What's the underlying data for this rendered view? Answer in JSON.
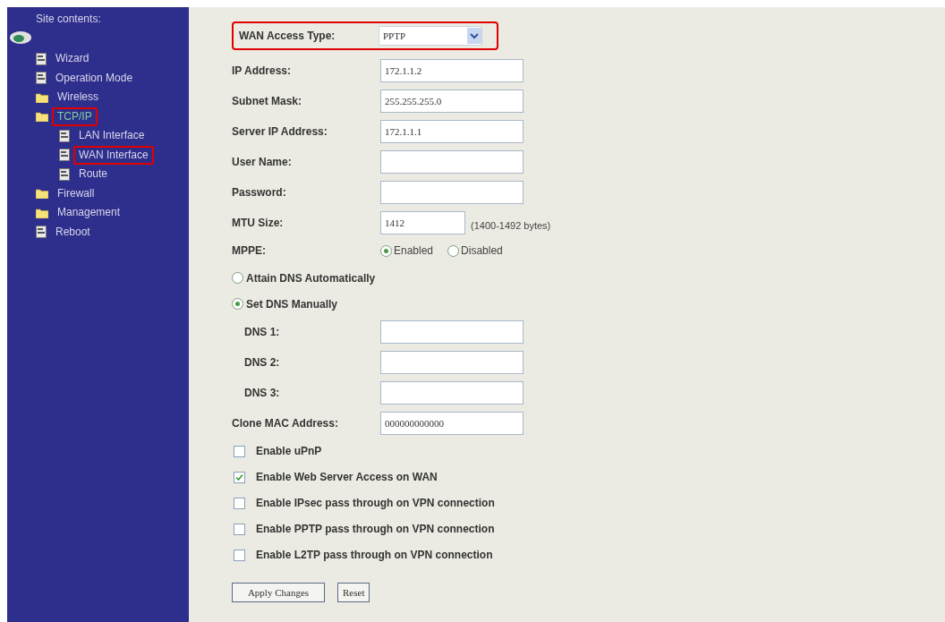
{
  "sidebar": {
    "title": "Site contents:",
    "items": [
      {
        "label": "Wizard",
        "kind": "page",
        "highlighted": false
      },
      {
        "label": "Operation Mode",
        "kind": "page",
        "highlighted": false
      },
      {
        "label": "Wireless",
        "kind": "folder",
        "highlighted": false
      },
      {
        "label": "TCP/IP",
        "kind": "folder",
        "highlighted": true,
        "expanded": true,
        "children": [
          {
            "label": "LAN Interface",
            "kind": "page",
            "highlighted": false
          },
          {
            "label": "WAN Interface",
            "kind": "page",
            "highlighted": true
          },
          {
            "label": "Route",
            "kind": "page",
            "highlighted": false
          }
        ]
      },
      {
        "label": "Firewall",
        "kind": "folder",
        "highlighted": false
      },
      {
        "label": "Management",
        "kind": "folder",
        "highlighted": false
      },
      {
        "label": "Reboot",
        "kind": "page",
        "highlighted": false
      }
    ]
  },
  "access_type": {
    "label": "WAN Access Type:",
    "value": "PPTP",
    "highlighted": true
  },
  "fields": [
    {
      "label": "IP Address:",
      "value": "172.1.1.2"
    },
    {
      "label": "Subnet Mask:",
      "value": "255.255.255.0"
    },
    {
      "label": "Server IP Address:",
      "value": "172.1.1.1"
    },
    {
      "label": "User Name:"
    },
    {
      "label": "Password:"
    },
    {
      "label": "MTU Size:",
      "value": "1412",
      "hint": "(1400-1492 bytes)"
    }
  ],
  "mppe": {
    "label": "MPPE:",
    "options": [
      {
        "label": "Enabled",
        "selected": true
      },
      {
        "label": "Disabled",
        "selected": false
      }
    ]
  },
  "dns_mode": [
    {
      "label": "Attain DNS Automatically",
      "selected": false
    },
    {
      "label": "Set DNS Manually",
      "selected": true
    }
  ],
  "dns_fields": [
    {
      "label": "DNS 1:"
    },
    {
      "label": "DNS 2:"
    },
    {
      "label": "DNS 3:"
    }
  ],
  "clone_mac": {
    "label": "Clone MAC Address:",
    "value": "000000000000"
  },
  "checkboxes": [
    {
      "label": "Enable uPnP",
      "checked": false
    },
    {
      "label": "Enable Web Server Access on WAN",
      "checked": true
    },
    {
      "label": "Enable IPsec pass through on VPN connection",
      "checked": false
    },
    {
      "label": "Enable PPTP pass through on VPN connection",
      "checked": false
    },
    {
      "label": "Enable L2TP pass through on VPN connection",
      "checked": false
    }
  ],
  "buttons": [
    "Apply Changes",
    "Reset"
  ]
}
